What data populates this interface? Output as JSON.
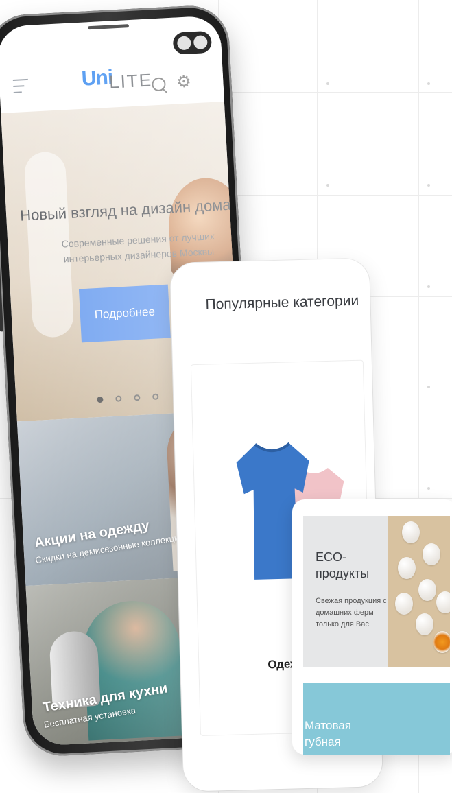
{
  "app": {
    "logo_text": "LITE",
    "logo_mark": "Uni",
    "brand_color": "#3d8df0"
  },
  "header": {
    "icons": [
      "menu-icon",
      "search-icon",
      "settings-icon"
    ]
  },
  "hero": {
    "title": "Новый взгляд на дизайн дома",
    "subtitle": "Современные решения от лучших интерьерных дизайнеров Москвы",
    "button_label": "Подробнее",
    "button_color": "#6b9ef0",
    "slides_total": 4,
    "active_slide": 1
  },
  "promos": [
    {
      "title": "Акции на одежду",
      "subtitle": "Скидки на демисезонные коллекции"
    },
    {
      "title": "Техника для кухни",
      "subtitle": "Бесплатная установка"
    }
  ],
  "categories": {
    "title": "Популярные категории",
    "item_label": "Одежда"
  },
  "eco_card": {
    "title_line1": "ECO-",
    "title_line2": "продукты",
    "subtitle": "Свежая продукция с домашних ферм только для Вас",
    "lip_title_line1": "Матовая",
    "lip_title_line2": "губная"
  }
}
